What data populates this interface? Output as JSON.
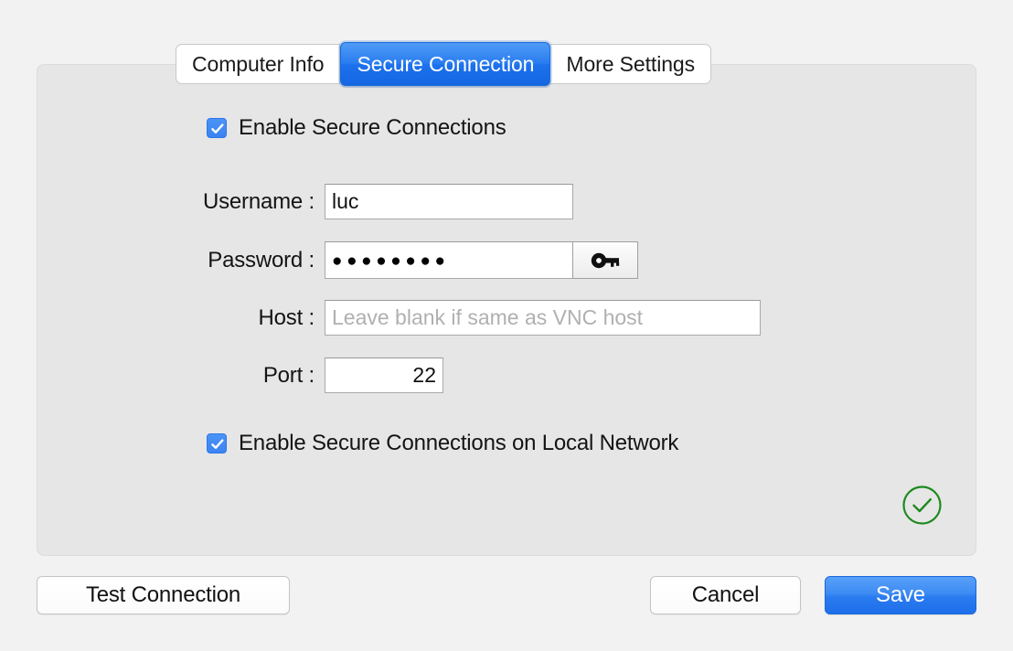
{
  "tabs": [
    {
      "label": "Computer Info",
      "active": false
    },
    {
      "label": "Secure Connection",
      "active": true
    },
    {
      "label": "More Settings",
      "active": false
    }
  ],
  "panel": {
    "enable_secure_connections": {
      "label": "Enable Secure Connections",
      "checked": true
    },
    "fields": [
      {
        "label": "Username :",
        "value": "luc",
        "placeholder": ""
      },
      {
        "label": "Password :",
        "value": "●●●●●●●●",
        "placeholder": ""
      },
      {
        "label": "Host :",
        "value": "",
        "placeholder": "Leave blank if same as VNC host"
      },
      {
        "label": "Port :",
        "value": "22",
        "placeholder": ""
      }
    ],
    "password_reveal": {
      "icon": "key-icon"
    },
    "enable_secure_connections_local": {
      "label": "Enable Secure Connections on Local Network",
      "checked": true
    },
    "status": {
      "icon": "circle-check-icon",
      "color": "#1e8a1e"
    }
  },
  "footer": {
    "test_connection_label": "Test Connection",
    "cancel_label": "Cancel",
    "save_label": "Save"
  },
  "colors": {
    "accent": "#2a7df0",
    "page_background": "#f2f2f2",
    "panel_background": "#e6e6e6",
    "status_green": "#1e8a1e"
  }
}
